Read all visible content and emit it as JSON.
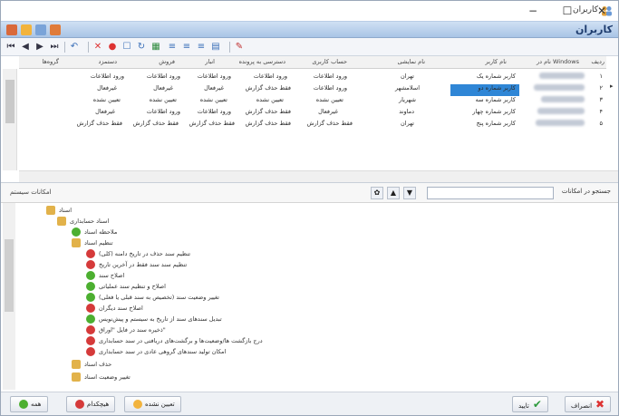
{
  "window": {
    "title": "کاربران",
    "controls": [
      "−",
      "☐",
      "✕"
    ]
  },
  "module": {
    "title": "کاربران"
  },
  "grid": {
    "columns": [
      "ردیف",
      "نام در Windows",
      "نام کاربر",
      "نام نمایشی",
      "حساب کاربری",
      "دسترسی به پرونده",
      "انبار",
      "فروش",
      "دستمزد",
      "گروه‌ها"
    ],
    "rows": [
      {
        "num": "۱",
        "user": "کاربر شماره یک",
        "city": "تهران",
        "c1": "ورود اطلاعات",
        "c2": "ورود اطلاعات",
        "c3": "ورود اطلاعات",
        "c4": "ورود اطلاعات",
        "c5": "ورود اطلاعات"
      },
      {
        "num": "۲",
        "user": "کاربر شماره دو",
        "city": "اسلامشهر",
        "c1": "ورود اطلاعات",
        "c2": "فقط حذف گزارش",
        "c3": "غیرفعال",
        "c4": "غیرفعال",
        "c5": "غیرفعال"
      },
      {
        "num": "۳",
        "user": "کاربر شماره سه",
        "city": "شهریار",
        "c1": "تعیین نشده",
        "c2": "تعیین نشده",
        "c3": "تعیین نشده",
        "c4": "تعیین نشده",
        "c5": "تعیین نشده"
      },
      {
        "num": "۴",
        "user": "کاربر شماره چهار",
        "city": "دماوند",
        "c1": "غیرفعال",
        "c2": "فقط حذف گزارش",
        "c3": "ورود اطلاعات",
        "c4": "ورود اطلاعات",
        "c5": "غیرفعال"
      },
      {
        "num": "۵",
        "user": "کاربر شماره پنج",
        "city": "تهران",
        "c1": "فقط حذف گزارش",
        "c2": "فقط حذف گزارش",
        "c3": "فقط حذف گزارش",
        "c4": "فقط حذف گزارش",
        "c5": "فقط حذف گزارش"
      }
    ]
  },
  "tree_panel": {
    "title": "امکانات سیستم",
    "search_label": "جستجو در امکانات",
    "search_value": "",
    "nodes": [
      {
        "label": "اسناد",
        "kind": "folder"
      },
      {
        "label": "اسناد حسابداری",
        "kind": "folder"
      },
      {
        "label": "ملاحظه اسناد",
        "kind": "ok"
      },
      {
        "label": "تنظیم اسناد",
        "kind": "folder"
      },
      {
        "label": "تنظیم سند حذف در تاریخ دامنه (کلی)",
        "kind": "no"
      },
      {
        "label": "تنظیم سند سند فقط در آخرین تاریخ",
        "kind": "no"
      },
      {
        "label": "اصلاح سند",
        "kind": "ok"
      },
      {
        "label": "اصلاح و تنظیم سند عملیاتی",
        "kind": "ok"
      },
      {
        "label": "تغییر وضعیت سند (تخصیص به سند قبلی یا فعلی)",
        "kind": "ok"
      },
      {
        "label": "اصلاح سند دیگران",
        "kind": "no"
      },
      {
        "label": "تبدیل سندهای سند از تاریخ به سیستم و پیش‌نویس",
        "kind": "ok"
      },
      {
        "label": "ذخیره سند در فایل \"اوراق\"",
        "kind": "no"
      },
      {
        "label": "درج بازگشت ها/وضعیت‌ها و برگشت‌های دریافتی در سند حسابداری",
        "kind": "no"
      },
      {
        "label": "امکان تولید سندهای گروهی عادی در سند حسابداری",
        "kind": "no"
      },
      {
        "label": "حذف اسناد",
        "kind": "folder"
      },
      {
        "label": "تغییر وضعیت اسناد",
        "kind": "folder"
      }
    ]
  },
  "footer": {
    "ok_label": "تایید",
    "cancel_label": "انصراف",
    "all_label": "همه",
    "none_label": "هیچکدام",
    "not_set_label": "تعیین نشده",
    "colors": {
      "ok": "#4caf30",
      "no": "#d53a3a",
      "select": "#2f86d6"
    }
  }
}
